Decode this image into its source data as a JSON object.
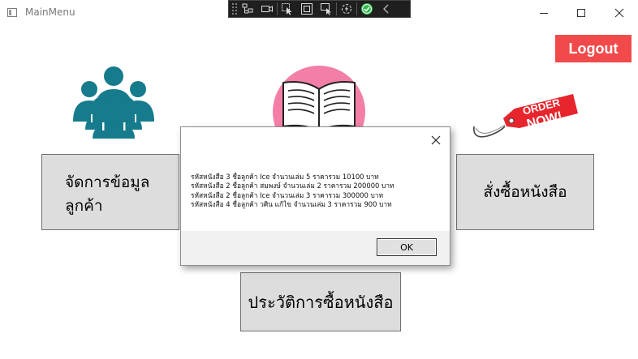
{
  "window": {
    "title": "MainMenu"
  },
  "header": {
    "logout_label": "Logout"
  },
  "menu": {
    "customer_line1": "จัดการข้อมูล",
    "customer_line2": "ลูกค้า",
    "order_label": "สั่งซื้อหนังสือ",
    "history_label": "ประวัติการซื้อหนังสือ"
  },
  "illustrations": {
    "tag_line1": "ORDER",
    "tag_line2": "NOW!"
  },
  "dialog": {
    "lines": [
      "รหัสหนังสือ 3 ชื่อลูกค้า Ice จำนวนเล่ม 5 ราคารวม 10100 บาท",
      "รหัสหนังสือ 2 ชื่อลูกค้า สมพงษ์ จำนวนเล่ม 2 ราคารวม 200000 บาท",
      "รหัสหนังสือ 2 ชื่อลูกค้า Ice จำนวนเล่ม 3 ราคารวม 300000 บาท",
      "รหัสหนังสือ 4 ชื่อลูกค้า วศิน แก้ไข จำนวนเล่ม 3 ราคารวม 900 บาท"
    ],
    "ok_label": "OK"
  },
  "colors": {
    "logout_bg": "#f24a4a",
    "people_icon": "#167b8d",
    "book_circle": "#f37fa8",
    "tag_red": "#e8242c"
  }
}
